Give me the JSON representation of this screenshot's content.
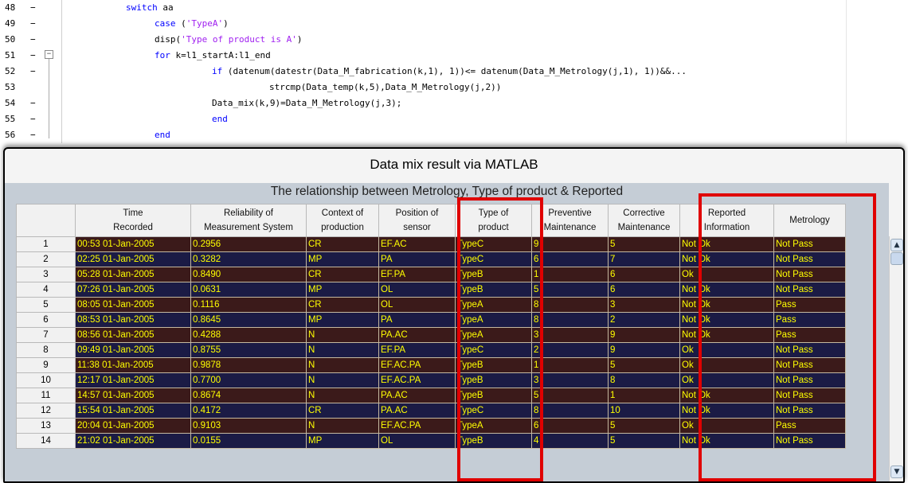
{
  "editor": {
    "lines": [
      {
        "num": "48",
        "dash": "−",
        "code": [
          {
            "t": "switch",
            "c": "kw"
          },
          {
            "t": " aa",
            "c": ""
          }
        ]
      },
      {
        "num": "49",
        "dash": "−",
        "code": [
          {
            "t": "case",
            "c": "kw"
          },
          {
            "t": " (",
            "c": ""
          },
          {
            "t": "'TypeA'",
            "c": "str"
          },
          {
            "t": ")",
            "c": ""
          }
        ]
      },
      {
        "num": "50",
        "dash": "−",
        "code": [
          {
            "t": "disp(",
            "c": ""
          },
          {
            "t": "'Type of product is A'",
            "c": "str"
          },
          {
            "t": ")",
            "c": ""
          }
        ]
      },
      {
        "num": "51",
        "dash": "−",
        "code": [
          {
            "t": "for",
            "c": "kw"
          },
          {
            "t": " k=l1_startA:l1_end",
            "c": ""
          }
        ]
      },
      {
        "num": "52",
        "dash": "−",
        "code": [
          {
            "t": "if",
            "c": "kw"
          },
          {
            "t": " (datenum(datestr(Data_M_fabrication(k,1), 1))<= datenum(Data_M_Metrology(j,1), 1))&&...",
            "c": ""
          }
        ]
      },
      {
        "num": "53",
        "dash": "",
        "code": [
          {
            "t": "strcmp(Data_temp(k,5),Data_M_Metrology(j,2))",
            "c": ""
          }
        ]
      },
      {
        "num": "54",
        "dash": "−",
        "code": [
          {
            "t": "Data_mix(k,9)=Data_M_Metrology(j,3);",
            "c": ""
          }
        ]
      },
      {
        "num": "55",
        "dash": "−",
        "code": [
          {
            "t": "end",
            "c": "kw"
          }
        ]
      },
      {
        "num": "56",
        "dash": "−",
        "code": [
          {
            "t": "end",
            "c": "kw"
          }
        ]
      }
    ],
    "fold_symbol": "−"
  },
  "panel": {
    "title": "Data mix result via MATLAB",
    "subtitle": "The relationship between Metrology, Type of product & Reported"
  },
  "table": {
    "headers": [
      [
        "Time",
        "Recorded"
      ],
      [
        "Reliability of",
        "Measurement System"
      ],
      [
        "Context of",
        "production"
      ],
      [
        "Position of",
        "sensor"
      ],
      [
        "Type of",
        "product"
      ],
      [
        "Preventive",
        "Maintenance"
      ],
      [
        "Corrective",
        "Maintenance"
      ],
      [
        "Reported",
        "Information"
      ],
      [
        "Metrology",
        ""
      ]
    ],
    "rows": [
      {
        "idx": "1",
        "cells": [
          "00:53 01-Jan-2005",
          "0.2956",
          "CR",
          "EF.AC",
          "TypeC",
          "9",
          "5",
          "Not Ok",
          "Not Pass"
        ]
      },
      {
        "idx": "2",
        "cells": [
          "02:25 01-Jan-2005",
          "0.3282",
          "MP",
          "PA",
          "TypeC",
          "6",
          "7",
          "Not Ok",
          "Not Pass"
        ]
      },
      {
        "idx": "3",
        "cells": [
          "05:28 01-Jan-2005",
          "0.8490",
          "CR",
          "EF.PA",
          "TypeB",
          "1",
          "6",
          "Ok",
          "Not Pass"
        ]
      },
      {
        "idx": "4",
        "cells": [
          "07:26 01-Jan-2005",
          "0.0631",
          "MP",
          "OL",
          "TypeB",
          "5",
          "6",
          "Not Ok",
          "Not Pass"
        ]
      },
      {
        "idx": "5",
        "cells": [
          "08:05 01-Jan-2005",
          "0.1116",
          "CR",
          "OL",
          "TypeA",
          "8",
          "3",
          "Not Ok",
          "Pass"
        ]
      },
      {
        "idx": "6",
        "cells": [
          "08:53 01-Jan-2005",
          "0.8645",
          "MP",
          "PA",
          "TypeA",
          "8",
          "2",
          "Not Ok",
          "Pass"
        ]
      },
      {
        "idx": "7",
        "cells": [
          "08:56 01-Jan-2005",
          "0.4288",
          "N",
          "PA.AC",
          "TypeA",
          "3",
          "9",
          "Not Ok",
          "Pass"
        ]
      },
      {
        "idx": "8",
        "cells": [
          "09:49 01-Jan-2005",
          "0.8755",
          "N",
          "EF.PA",
          "TypeC",
          "2",
          "9",
          "Ok",
          "Not Pass"
        ]
      },
      {
        "idx": "9",
        "cells": [
          "11:38 01-Jan-2005",
          "0.9878",
          "N",
          "EF.AC.PA",
          "TypeB",
          "1",
          "5",
          "Ok",
          "Not Pass"
        ]
      },
      {
        "idx": "10",
        "cells": [
          "12:17 01-Jan-2005",
          "0.7700",
          "N",
          "EF.AC.PA",
          "TypeB",
          "3",
          "8",
          "Ok",
          "Not Pass"
        ]
      },
      {
        "idx": "11",
        "cells": [
          "14:57 01-Jan-2005",
          "0.8674",
          "N",
          "PA.AC",
          "TypeB",
          "5",
          "1",
          "Not Ok",
          "Not Pass"
        ]
      },
      {
        "idx": "12",
        "cells": [
          "15:54 01-Jan-2005",
          "0.4172",
          "CR",
          "PA.AC",
          "TypeC",
          "8",
          "10",
          "Not Ok",
          "Not Pass"
        ]
      },
      {
        "idx": "13",
        "cells": [
          "20:04 01-Jan-2005",
          "0.9103",
          "N",
          "EF.AC.PA",
          "TypeA",
          "6",
          "5",
          "Ok",
          "Pass"
        ]
      },
      {
        "idx": "14",
        "cells": [
          "21:02 01-Jan-2005",
          "0.0155",
          "MP",
          "OL",
          "TypeB",
          "4",
          "5",
          "Not Ok",
          "Not Pass"
        ]
      }
    ]
  },
  "scrollbar": {
    "up_icon": "▲",
    "down_icon": "▼"
  },
  "colors": {
    "highlight": "#e00000",
    "cell_text": "#ffff00",
    "row_dark": "#3b1a1a",
    "row_navy": "#1b1b45"
  }
}
